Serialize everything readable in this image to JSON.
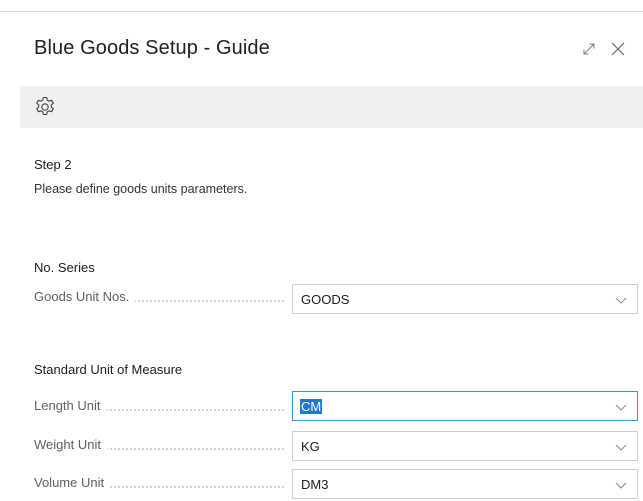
{
  "dialog": {
    "title": "Blue Goods Setup - Guide"
  },
  "step": {
    "title": "Step 2",
    "description": "Please define goods units parameters."
  },
  "sections": {
    "no_series": {
      "title": "No. Series",
      "fields": [
        {
          "label": "Goods Unit Nos.",
          "value": "GOODS"
        }
      ]
    },
    "uom": {
      "title": "Standard Unit of Measure",
      "fields": [
        {
          "label": "Length Unit",
          "value": "CM"
        },
        {
          "label": "Weight Unit",
          "value": "KG"
        },
        {
          "label": "Volume Unit",
          "value": "DM3"
        }
      ]
    }
  },
  "icons": {
    "expand": "expand-icon",
    "close": "close-icon",
    "settings": "gear-icon",
    "dropdown": "chevron-down-icon"
  },
  "colors": {
    "toolbar_bg": "#f0f0f0",
    "focus_border": "#3a93c9",
    "selection": "#1f78d1"
  }
}
